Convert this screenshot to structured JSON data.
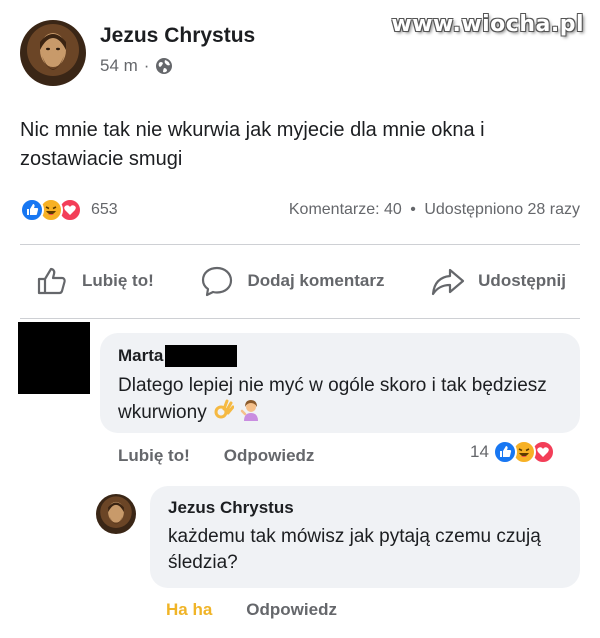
{
  "watermark": "www.wiocha.pl",
  "post": {
    "author": "Jezus Chrystus",
    "time": "54 m",
    "separator": "·",
    "privacy_icon": "globe-icon",
    "text": "Nic mnie tak nie wkurwia jak myjecie dla mnie okna i zostawiacie smugi",
    "reactions": {
      "icons": [
        "like-icon",
        "haha-icon",
        "love-icon"
      ],
      "count": "653"
    },
    "comments": "Komentarze: 40",
    "dot": "•",
    "shares": "Udostępniono 28 razy"
  },
  "actions": {
    "like": "Lubię to!",
    "comment": "Dodaj komentarz",
    "share": "Udostępnij"
  },
  "comments": [
    {
      "author": "Marta",
      "text": "Dlatego lepiej nie myć w ogóle skoro i tak będziesz wkurwiony",
      "like_label": "Lubię to!",
      "reply_label": "Odpowiedz",
      "reaction_count": "14",
      "reaction_icons": [
        "like-icon",
        "haha-icon",
        "love-icon"
      ]
    },
    {
      "author": "Jezus Chrystus",
      "text": "każdemu tak mówisz jak pytają czemu czują śledzia?",
      "like_label": "Ha ha",
      "reply_label": "Odpowiedz"
    }
  ],
  "colors": {
    "like": "#1877f2",
    "haha": "#f7b125",
    "love": "#f33e58",
    "bubble": "#f0f2f5",
    "muted": "#65676b"
  }
}
